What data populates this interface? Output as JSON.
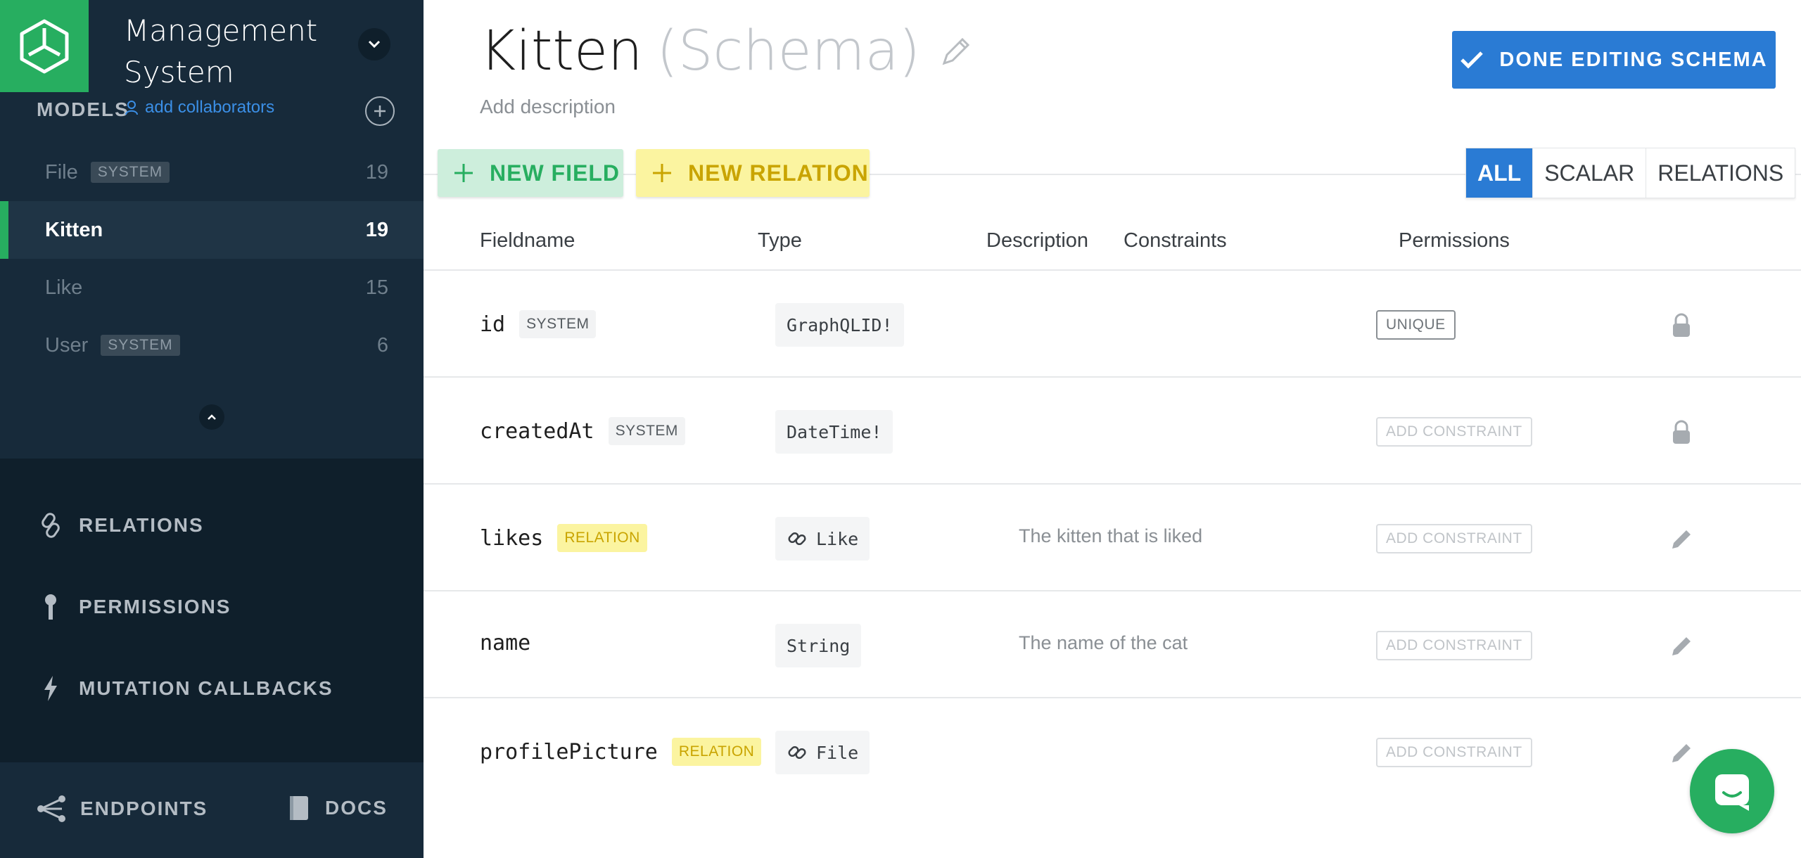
{
  "sidebar": {
    "project_title": "Management System",
    "models_label": "MODELS",
    "add_collaborators": "add collaborators",
    "models": [
      {
        "name": "File",
        "badge": "SYSTEM",
        "count": "19"
      },
      {
        "name": "Kitten",
        "badge": "",
        "count": "19",
        "active": true
      },
      {
        "name": "Like",
        "badge": "",
        "count": "15"
      },
      {
        "name": "User",
        "badge": "SYSTEM",
        "count": "6"
      }
    ],
    "nav": {
      "relations": "RELATIONS",
      "permissions": "PERMISSIONS",
      "mutation_callbacks": "MUTATION CALLBACKS"
    },
    "footer": {
      "endpoints": "ENDPOINTS",
      "docs": "DOCS"
    }
  },
  "header": {
    "model_name": "Kitten",
    "schema_suffix": "(Schema)",
    "description_placeholder": "Add description",
    "done_button": "DONE EDITING SCHEMA"
  },
  "toolbar": {
    "new_field": "NEW FIELD",
    "new_relation": "NEW RELATION",
    "filters": [
      "ALL",
      "SCALAR",
      "RELATIONS"
    ],
    "active_filter": "ALL"
  },
  "table": {
    "columns": [
      "Fieldname",
      "Type",
      "Description",
      "Constraints",
      "Permissions"
    ],
    "rows": [
      {
        "name": "id",
        "badge": "SYSTEM",
        "type": "GraphQLID!",
        "description": "",
        "constraint": "UNIQUE",
        "icon": "lock-icon"
      },
      {
        "name": "createdAt",
        "badge": "SYSTEM",
        "type": "DateTime!",
        "description": "",
        "constraint": "ADD CONSTRAINT",
        "icon": "lock-icon"
      },
      {
        "name": "likes",
        "badge": "RELATION",
        "type": "Like",
        "description": "The kitten that is liked",
        "constraint": "ADD CONSTRAINT",
        "icon": "pencil-icon"
      },
      {
        "name": "name",
        "badge": "",
        "type": "String",
        "description": "The name of the cat",
        "constraint": "ADD CONSTRAINT",
        "icon": "pencil-icon"
      },
      {
        "name": "profilePicture",
        "badge": "RELATION",
        "type": "File",
        "description": "",
        "constraint": "ADD CONSTRAINT",
        "icon": "pencil-icon"
      }
    ]
  },
  "colors": {
    "sidebar_bg": "#172a3a",
    "accent_green": "#27ae60",
    "accent_blue": "#2a7bd4",
    "relation_yellow": "#fbf4a0"
  }
}
